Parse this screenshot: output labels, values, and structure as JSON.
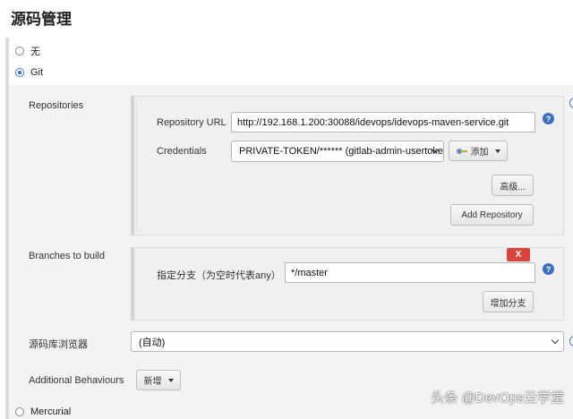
{
  "page": {
    "title": "源码管理"
  },
  "scm_options": {
    "none": "无",
    "git": "Git",
    "mercurial": "Mercurial"
  },
  "repositories": {
    "section_label": "Repositories",
    "url_label": "Repository URL",
    "url_value": "http://192.168.1.200:30088/idevops/idevops-maven-service.git",
    "credentials_label": "Credentials",
    "credentials_value": "PRIVATE-TOKEN/****** (gitlab-admin-usertoken)",
    "add_label": "添加",
    "advanced_label": "高级...",
    "add_repository_label": "Add Repository"
  },
  "branches": {
    "section_label": "Branches to build",
    "delete_label": "X",
    "branch_label": "指定分支（为空时代表any）",
    "branch_value": "*/master",
    "add_branch_label": "增加分支"
  },
  "browser": {
    "label": "源码库浏览器",
    "value": "(自动)"
  },
  "behaviours": {
    "label": "Additional Behaviours",
    "add_label": "新增"
  },
  "help": {
    "glyph": "?"
  },
  "watermark": {
    "text": "头条 @DevOps云学堂"
  }
}
